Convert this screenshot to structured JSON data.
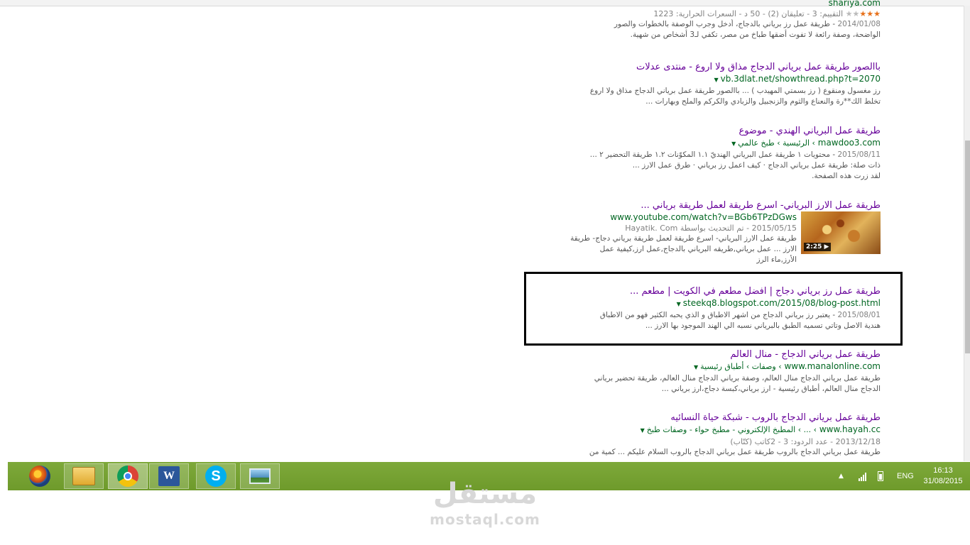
{
  "results": [
    {
      "url": "shariya.com",
      "rating_label": "التقييم: 3",
      "stars": 3,
      "meta": " - تعليقان (2) - 50 د - السعرات الحرارية: 1223",
      "date": "2014/01/08",
      "snippet_line1": " - طريقة عمل رز برياني بالدجاج، أدخل وجرب الوصفة بالخطوات والصور",
      "snippet_line2": "الواضحة، وصفة رائعة لا تفوت أضقها طباخ من مصر، تكفي لـ3 أشخاص من شهية."
    },
    {
      "title": "باالصور طريقة عمل برياني الدجاج مذاق ولا اروع - منتدى عدلات",
      "url": "vb.3dlat.net/showthread.php?t=2070",
      "snippet_line1": "رز مغسول ومنقوع ( رز بسمتي المهيدب ) ... باالصور طريقة عمل برياني الدجاج مذاق ولا اروع",
      "snippet_line2": "تخلط الك**رة والنعناع والثوم والزنجبيل والزبادي والكركم والملح وبهارات ..."
    },
    {
      "title": "طريقة عمل البرياني الهندي - موضوع",
      "url": "mawdoo3.com",
      "breadcrumb": "› الرئيسية › طبخ عالمي",
      "date": "2015/08/11",
      "snippet_line1": " - محتويات ١ طريقة عمل البرياني الهنديّ ١.١ المكوّنات ١.٢ طريقة التحضير ٢ ...",
      "snippet_line2": "ذات صلة: طريقة عمل برياني الدجاج · كيف اعمل رز برياني · طرق عمل الارز ...",
      "snippet_line3": "لقد زرت هذه الصفحة."
    },
    {
      "title": "طريقة عمل الارز البرياني- اسرع طريقة لعمل طريقة برياني ...",
      "url": "www.youtube.com/watch?v=BGb6TPzDGws",
      "date": "2015/05/15",
      "uploaded_by": " - تم التحديث بواسطة Hayatik. Com",
      "snippet_line1": "طريقة عمل الارز البرياني- اسرع طريقة لعمل طريقة برياني دجاج- طريقة",
      "snippet_line2": "الارز ... عمل برياني,طريقه البرياني بالدجاج,عمل ارز,كيفية عمل",
      "snippet_line3": "الأرز,ماء الرز",
      "video_duration": "2:25 ▶"
    },
    {
      "title": "طريقة عمل رز برياني دجاج | افضل مطعم في الكويت | مطعم ...",
      "url": "steekq8.blogspot.com/2015/08/blog-post.html",
      "date": "2015/08/01",
      "snippet_line1": " - يعتبر رز برياني الدجاج من اشهر الاطباق و الذي يحبه الكثير فهو من الاطباق",
      "snippet_line2": "هندية الاصل وتاتي تسميه الطبق بالبرياني نسبه الي الهند الموجود بها الارز ..."
    },
    {
      "title": "طريقة عمل برياني الدجاج - منال العالم",
      "url": "www.manalonline.com",
      "breadcrumb": "› وصفات › أطباق رئيسية",
      "snippet_line1": "طريقة عمل برياني الدجاج منال العالم، وصفة برياني الدجاج منال العالم، طريقة تحضير برياني",
      "snippet_line2": "الدجاج منال العالم، أطباق رئيسية - ارز برياني،كبسة دجاج،ارز برياني ..."
    },
    {
      "title": "طريقة عمل برياني الدجاج بالروب - شبكة حياة النسائيه",
      "url": "www.hayah.cc",
      "breadcrumb": "› ... › المطبخ الإلكتروني - مطبخ حواء - وصفات طبخ",
      "date": "2013/12/18",
      "meta": " - عدد الردود: 3 - 2كاتب (كتّاب)",
      "snippet_line1": "طريقة عمل برياني الدجاج بالروب طريقة عمل برياني الدجاج بالروب السلام عليكم ... كمية من"
    }
  ],
  "taskbar": {
    "apps": [
      "firefox-icon",
      "file-explorer-icon",
      "chrome-icon",
      "word-icon",
      "skype-icon",
      "photo-viewer-icon"
    ],
    "word_letter": "W",
    "skype_letter": "S",
    "tray_arrow": "▲",
    "language": "ENG",
    "time": "16:13",
    "date": "31/08/2015"
  },
  "watermark": {
    "arabic": "مستقل",
    "latin": "mostaql.com"
  },
  "colors": {
    "title": "#660099",
    "url": "#006621",
    "snippet": "#545454",
    "taskbar": "#7ea93a"
  }
}
